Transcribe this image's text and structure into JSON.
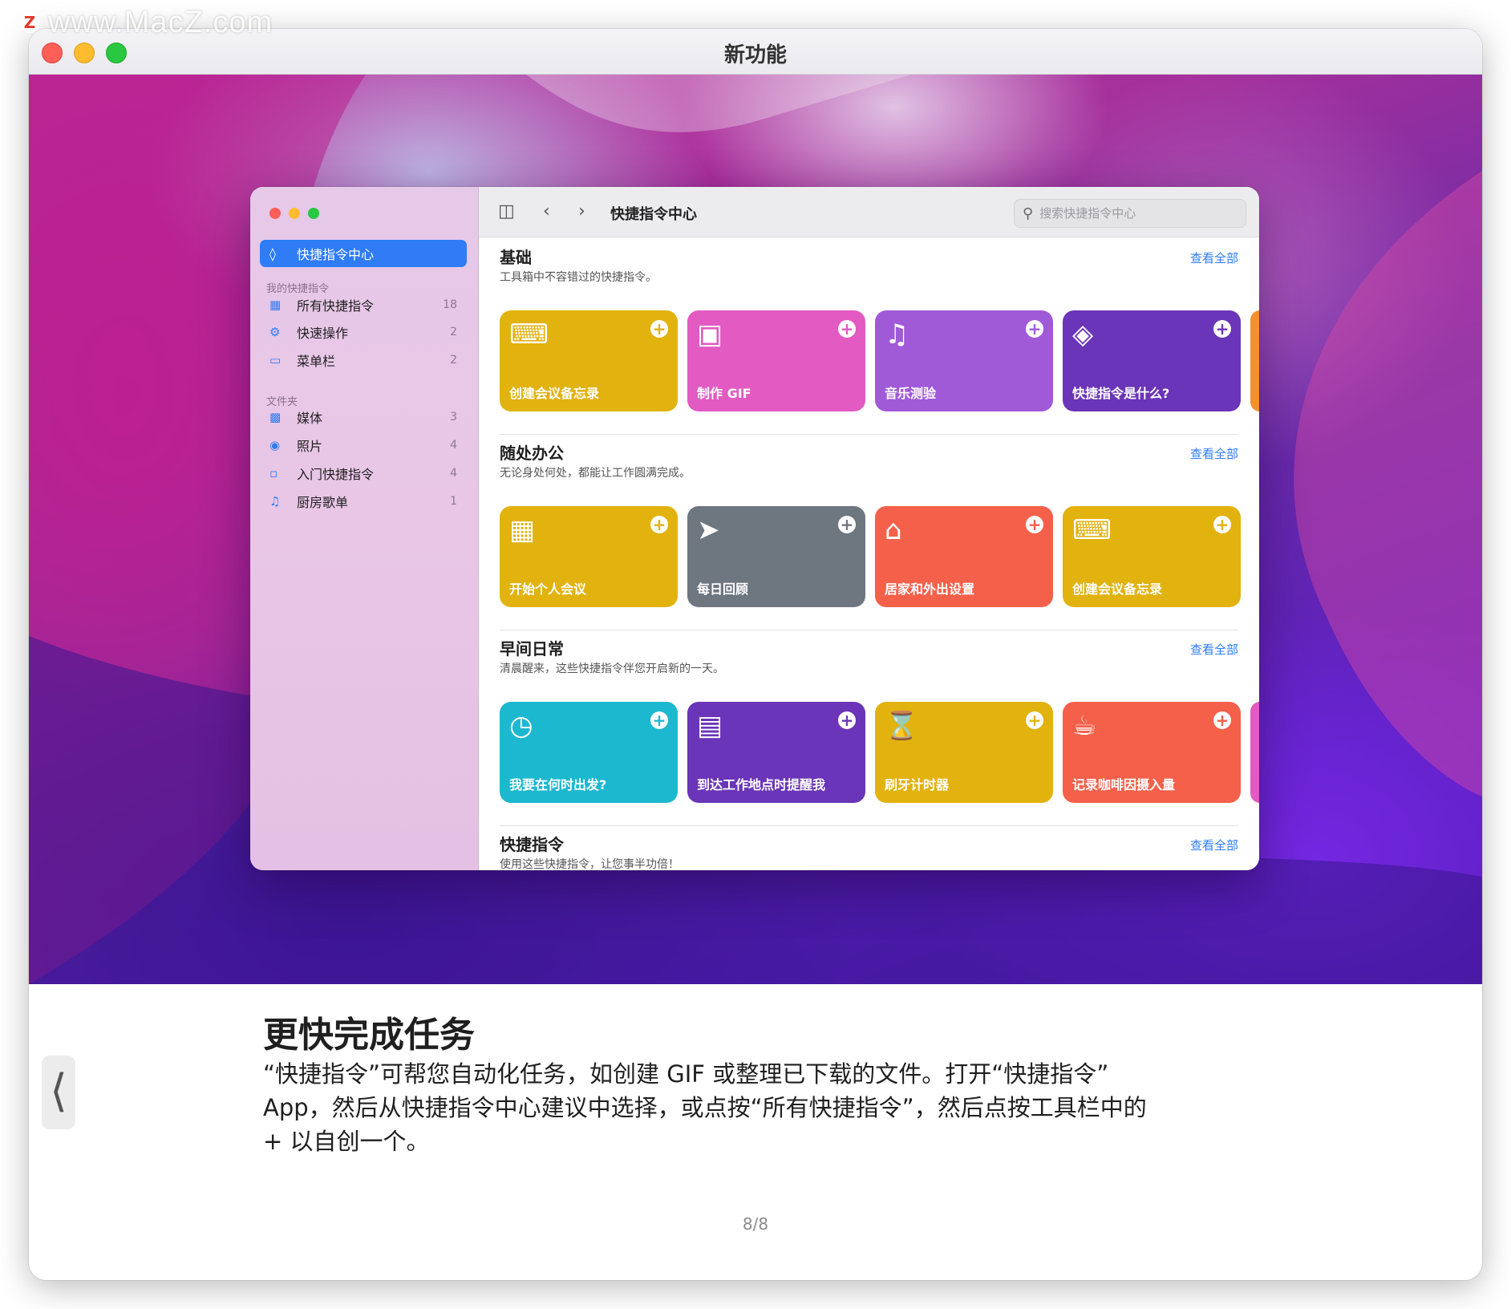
{
  "watermark": {
    "logo": "Z",
    "text": "www.MacZ.com"
  },
  "window": {
    "title": "新功能"
  },
  "app": {
    "sidebar": {
      "selected": {
        "label": "快捷指令中心",
        "icon": "stack-icon"
      },
      "my_shortcuts_header": "我的快捷指令",
      "my_shortcuts": [
        {
          "label": "所有快捷指令",
          "count": "18",
          "icon": "grid-icon"
        },
        {
          "label": "快速操作",
          "count": "2",
          "icon": "gear-icon"
        },
        {
          "label": "菜单栏",
          "count": "2",
          "icon": "menubar-icon"
        }
      ],
      "folders_header": "文件夹",
      "folders": [
        {
          "label": "媒体",
          "count": "3",
          "icon": "film-icon"
        },
        {
          "label": "照片",
          "count": "4",
          "icon": "camera-icon"
        },
        {
          "label": "入门快捷指令",
          "count": "4",
          "icon": "folder-icon"
        },
        {
          "label": "厨房歌单",
          "count": "1",
          "icon": "music-list-icon"
        }
      ]
    },
    "toolbar": {
      "title": "快捷指令中心",
      "search_placeholder": "搜索快捷指令中心"
    },
    "sections": [
      {
        "title": "基础",
        "subtitle": "工具箱中不容错过的快捷指令。",
        "link": "查看全部",
        "cards": [
          {
            "label": "创建会议备忘录",
            "color": "#e2b20f",
            "icon": "keyboard-icon"
          },
          {
            "label": "制作 GIF",
            "color": "#e25ac2",
            "icon": "photos-icon"
          },
          {
            "label": "音乐测验",
            "color": "#a05ad8",
            "icon": "music-note-icon"
          },
          {
            "label": "快捷指令是什么?",
            "color": "#6a35b8",
            "icon": "layers-icon"
          }
        ],
        "peek_color": "#f2912e"
      },
      {
        "title": "随处办公",
        "subtitle": "无论身处何处，都能让工作圆满完成。",
        "link": "查看全部",
        "cards": [
          {
            "label": "开始个人会议",
            "color": "#e2b20f",
            "icon": "calendar-icon"
          },
          {
            "label": "每日回顾",
            "color": "#6e7680",
            "icon": "running-icon"
          },
          {
            "label": "居家和外出设置",
            "color": "#f4604a",
            "icon": "home-icon"
          },
          {
            "label": "创建会议备忘录",
            "color": "#e2b20f",
            "icon": "keyboard-icon"
          }
        ]
      },
      {
        "title": "早间日常",
        "subtitle": "清晨醒来，这些快捷指令伴您开启新的一天。",
        "link": "查看全部",
        "cards": [
          {
            "label": "我要在何时出发?",
            "color": "#1cb8d0",
            "icon": "clock-icon"
          },
          {
            "label": "到达工作地点时提醒我",
            "color": "#6a35b8",
            "icon": "briefcase-icon"
          },
          {
            "label": "刷牙计时器",
            "color": "#e2b20f",
            "icon": "hourglass-icon"
          },
          {
            "label": "记录咖啡因摄入量",
            "color": "#f4604a",
            "icon": "coffee-cup-icon"
          }
        ],
        "peek_color": "#e25ac2"
      },
      {
        "title": "快捷指令",
        "subtitle": "使用这些快捷指令，让您事半功倍！",
        "link": "查看全部",
        "cards": []
      }
    ]
  },
  "footer": {
    "heading": "更快完成任务",
    "body_lines": [
      "“快捷指令”可帮您自动化任务，如创建 GIF 或整理已下载的文件。打开“快捷指令”",
      "App，然后从快捷指令中心建议中选择，或点按“所有快捷指令”，然后点按工具栏中的",
      "+ 以自创一个。"
    ],
    "page_indicator": "8/8",
    "prev_icon": "chevron-left-icon"
  }
}
